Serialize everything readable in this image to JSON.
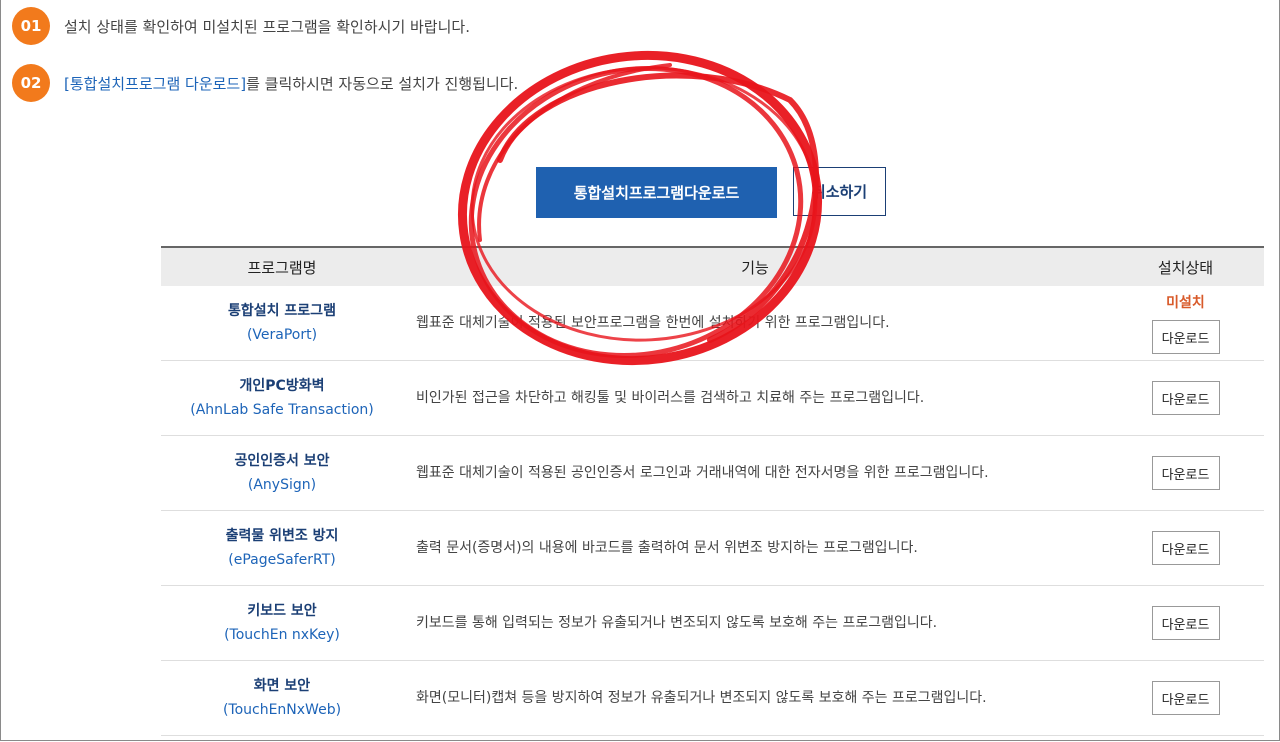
{
  "steps": [
    {
      "badge": "01",
      "text": "설치 상태를 확인하여 미설치된 프로그램을 확인하시기 바랍니다."
    },
    {
      "badge": "02",
      "link_text": "[통합설치프로그램 다운로드]",
      "text": "를 클릭하시면 자동으로 설치가 진행됩니다."
    }
  ],
  "buttons": {
    "download_all": "통합설치프로그램다운로드",
    "cancel": "취소하기"
  },
  "table": {
    "headers": {
      "name": "프로그램명",
      "function": "기능",
      "status": "설치상태"
    },
    "rows": [
      {
        "name": "통합설치 프로그램",
        "sub": "(VeraPort)",
        "func": "웹표준 대체기술이 적용된 보안프로그램을 한번에 설치하기 위한 프로그램입니다.",
        "status": "미설치",
        "button": "다운로드"
      },
      {
        "name": "개인PC방화벽",
        "sub": "(AhnLab Safe Transaction)",
        "func": "비인가된 접근을 차단하고 해킹툴 및 바이러스를 검색하고 치료해 주는 프로그램입니다.",
        "status": "",
        "button": "다운로드"
      },
      {
        "name": "공인인증서 보안",
        "sub": "(AnySign)",
        "func": "웹표준 대체기술이 적용된 공인인증서 로그인과 거래내역에 대한 전자서명을 위한 프로그램입니다.",
        "status": "",
        "button": "다운로드"
      },
      {
        "name": "출력물 위변조 방지",
        "sub": "(ePageSaferRT)",
        "func": "출력 문서(증명서)의 내용에 바코드를 출력하여 문서 위변조 방지하는 프로그램입니다.",
        "status": "",
        "button": "다운로드"
      },
      {
        "name": "키보드 보안",
        "sub": "(TouchEn nxKey)",
        "func": "키보드를 통해 입력되는 정보가 유출되거나 변조되지 않도록 보호해 주는 프로그램입니다.",
        "status": "",
        "button": "다운로드"
      },
      {
        "name": "화면 보안",
        "sub": "(TouchEnNxWeb)",
        "func": "화면(모니터)캡쳐 등을 방지하여 정보가 유출되거나 변조되지 않도록 보호해 주는 프로그램입니다.",
        "status": "",
        "button": "다운로드"
      }
    ]
  },
  "colors": {
    "badge": "#f27a1c",
    "primary_button": "#1f61b0",
    "annotation": "#e8141b",
    "status_missing": "#d85a2a"
  }
}
